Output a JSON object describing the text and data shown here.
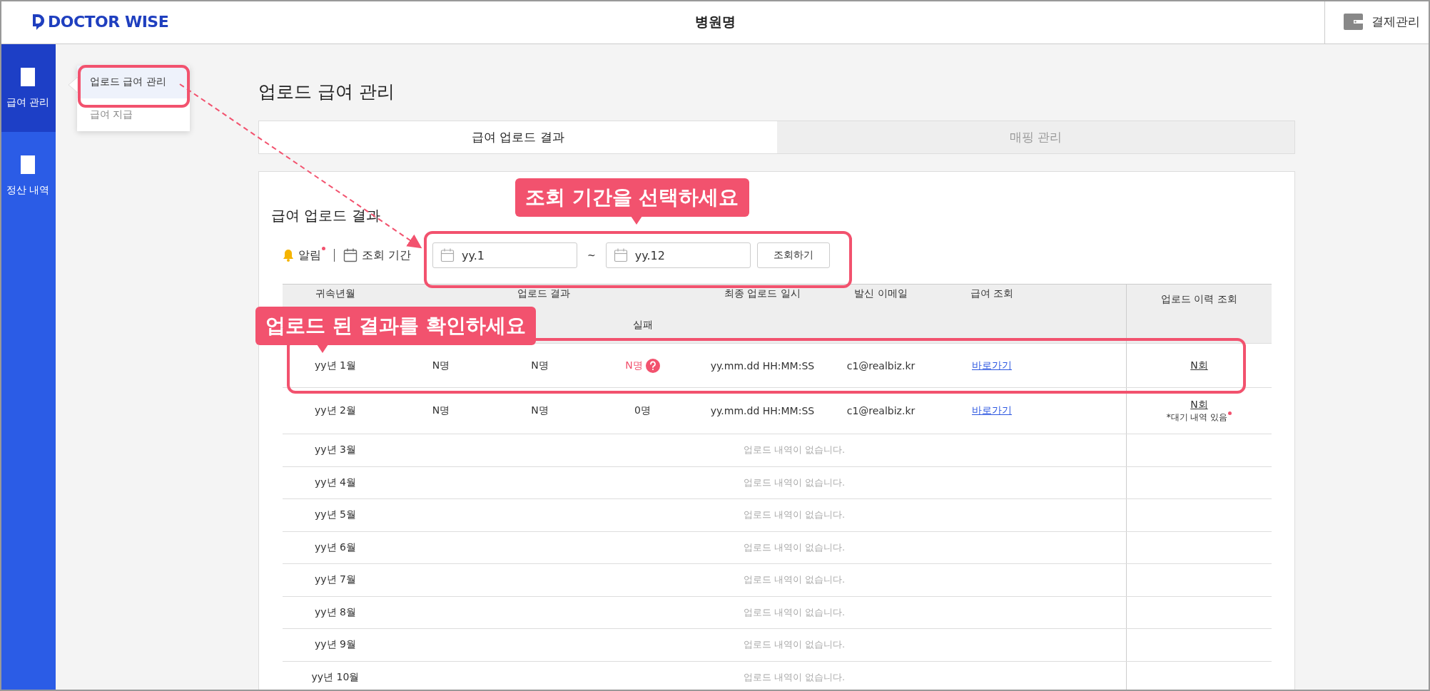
{
  "header": {
    "logo": "DOCTOR WISE",
    "title": "병원명",
    "billing": "결제관리"
  },
  "sidebar": {
    "items": [
      {
        "label": "급여 관리",
        "selected": true
      },
      {
        "label": "정산 내역",
        "selected": false
      }
    ]
  },
  "submenu": {
    "items": [
      {
        "label": "업로드 급여 관리",
        "selected": true
      },
      {
        "label": "급여 지급",
        "selected": false
      }
    ]
  },
  "page_title": "업로드 급여 관리",
  "tabs": [
    {
      "label": "급여 업로드 결과",
      "selected": true
    },
    {
      "label": "매핑 관리",
      "selected": false
    }
  ],
  "card": {
    "title": "급여 업로드 결과",
    "filter": {
      "alert": "알림",
      "alert_unread": true,
      "period_label": "조회 기간",
      "from": "yy.1",
      "separator": "~",
      "to": "yy.12",
      "button": "조회하기"
    },
    "table": {
      "columns": [
        {
          "kind": "single",
          "label": "귀속년월"
        },
        {
          "kind": "group",
          "label": "업로드 결과",
          "sub_label": "실패"
        },
        {
          "kind": "single",
          "label": "최종 업로드 일시"
        },
        {
          "kind": "single",
          "label": "발신 이메일"
        },
        {
          "kind": "single",
          "label": "급여 조회"
        },
        {
          "kind": "history",
          "label": "업로드 이력 조회"
        }
      ],
      "rows": [
        {
          "kind": "data",
          "month": "yy년 1월",
          "total": "N명",
          "success": "N명",
          "failed": "N명",
          "failed_alert": true,
          "last_upload": "yy.mm.dd HH:MM:SS",
          "email": "c1@realbiz.kr",
          "link": "바로가기",
          "history": "N회"
        },
        {
          "kind": "data",
          "month": "yy년 2월",
          "total": "N명",
          "success": "N명",
          "failed": "0명",
          "failed_alert": false,
          "last_upload": "yy.mm.dd HH:MM:SS",
          "email": "c1@realbiz.kr",
          "link": "바로가기",
          "history": "N회",
          "note": "*대기 내역 있음"
        },
        {
          "kind": "empty",
          "month": "yy년 3월",
          "message": "업로드 내역이 없습니다."
        },
        {
          "kind": "empty",
          "month": "yy년 4월",
          "message": "업로드 내역이 없습니다."
        },
        {
          "kind": "empty",
          "month": "yy년 5월",
          "message": "업로드 내역이 없습니다."
        },
        {
          "kind": "empty",
          "month": "yy년 6월",
          "message": "업로드 내역이 없습니다."
        },
        {
          "kind": "empty",
          "month": "yy년 7월",
          "message": "업로드 내역이 없습니다."
        },
        {
          "kind": "empty",
          "month": "yy년 8월",
          "message": "업로드 내역이 없습니다."
        },
        {
          "kind": "empty",
          "month": "yy년 9월",
          "message": "업로드 내역이 없습니다."
        },
        {
          "kind": "empty",
          "month": "yy년 10월",
          "message": "업로드 내역이 없습니다."
        }
      ]
    }
  },
  "annotations": [
    {
      "kind": "callout",
      "text": "조회 기간을 선택하세요"
    },
    {
      "kind": "callout",
      "text": "업로드 된 결과를 확인하세요"
    }
  ]
}
